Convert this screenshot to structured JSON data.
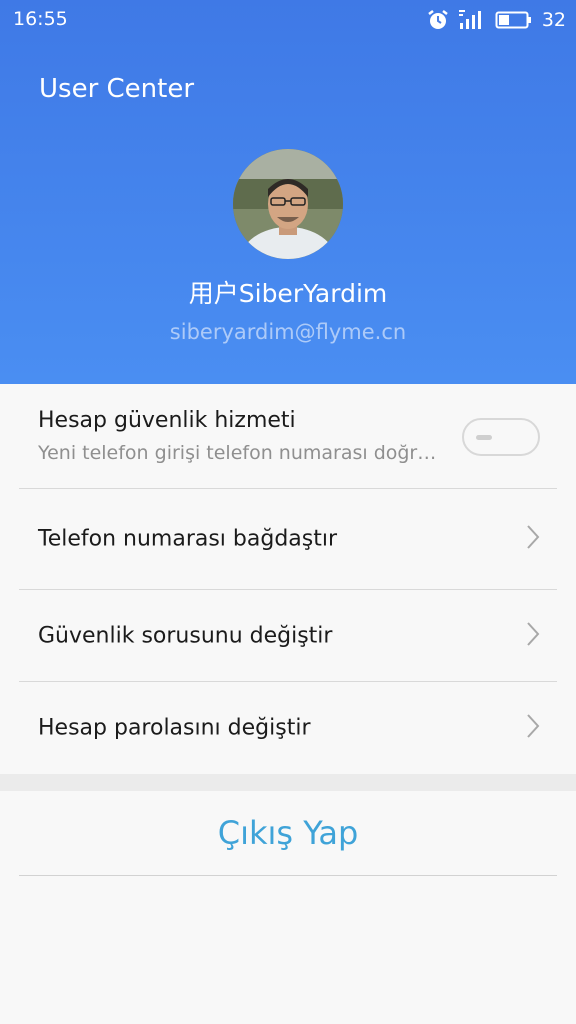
{
  "status_bar": {
    "time": "16:55",
    "battery": "32",
    "icons": [
      "alarm-icon",
      "signal-icon",
      "battery-icon"
    ]
  },
  "header": {
    "title": "User Center",
    "user_name": "用户SiberYardim",
    "email": "siberyardim@flyme.cn",
    "gradient_top": "#3f79e6",
    "gradient_bottom": "#4a8ef2"
  },
  "menu": {
    "security": {
      "title": "Hesap güvenlik hizmeti",
      "subtitle": "Yeni telefon girişi telefon numarası doğrulaması gerekir",
      "toggle_on": false
    },
    "items": [
      {
        "label": "Telefon numarası bağdaştır",
        "icon": "chevron-right-icon"
      },
      {
        "label": "Güvenlik sorusunu değiştir",
        "icon": "chevron-right-icon"
      },
      {
        "label": "Hesap parolasını değiştir",
        "icon": "chevron-right-icon"
      }
    ]
  },
  "logout": {
    "label": "Çıkış Yap",
    "color": "#3fa3d8"
  }
}
